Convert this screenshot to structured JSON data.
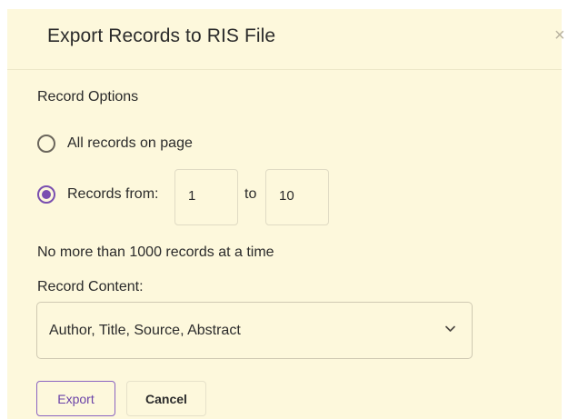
{
  "dialog": {
    "title": "Export Records to RIS File",
    "close_symbol": "×"
  },
  "record_options": {
    "label": "Record Options",
    "option_all": {
      "label": "All records on page",
      "selected": false
    },
    "option_range": {
      "label": "Records from:",
      "selected": true,
      "from_value": "1",
      "to_label": "to",
      "to_value": "10"
    },
    "note": "No more than 1000 records at a time"
  },
  "record_content": {
    "label": "Record Content:",
    "selected_value": "Author, Title, Source, Abstract"
  },
  "buttons": {
    "export_label": "Export",
    "cancel_label": "Cancel"
  },
  "colors": {
    "dialog_background": "#fdf8dc",
    "accent": "#7a4fb0",
    "text": "#2b2b2b"
  }
}
